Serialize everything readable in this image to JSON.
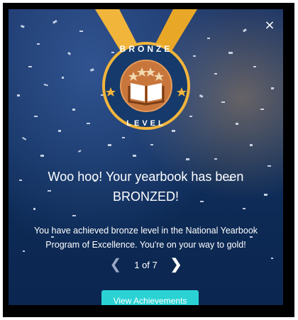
{
  "modal": {
    "close_symbol": "×",
    "badge": {
      "top_text": "BRONZE",
      "bottom_text": "LEVEL",
      "icon": "open-book-icon",
      "star_count": 4
    },
    "headline_line1": "Woo hoo! Your yearbook has been",
    "headline_line2": "BRONZED!",
    "message_line1": "You have achieved bronze level in the National Yearbook",
    "message_line2": "Program of Excellence. You're on your way to gold!",
    "pager": {
      "prev_icon": "chevron-left-icon",
      "next_icon": "chevron-right-icon",
      "label": "1 of 7"
    },
    "button_label": "View Achievements"
  },
  "colors": {
    "background_top": "#1a3567",
    "background_bottom": "#0b2650",
    "bronze": "#c8763c",
    "ribbon": "#f2b53c",
    "button": "#2ad2d4",
    "text": "#ffffff"
  }
}
